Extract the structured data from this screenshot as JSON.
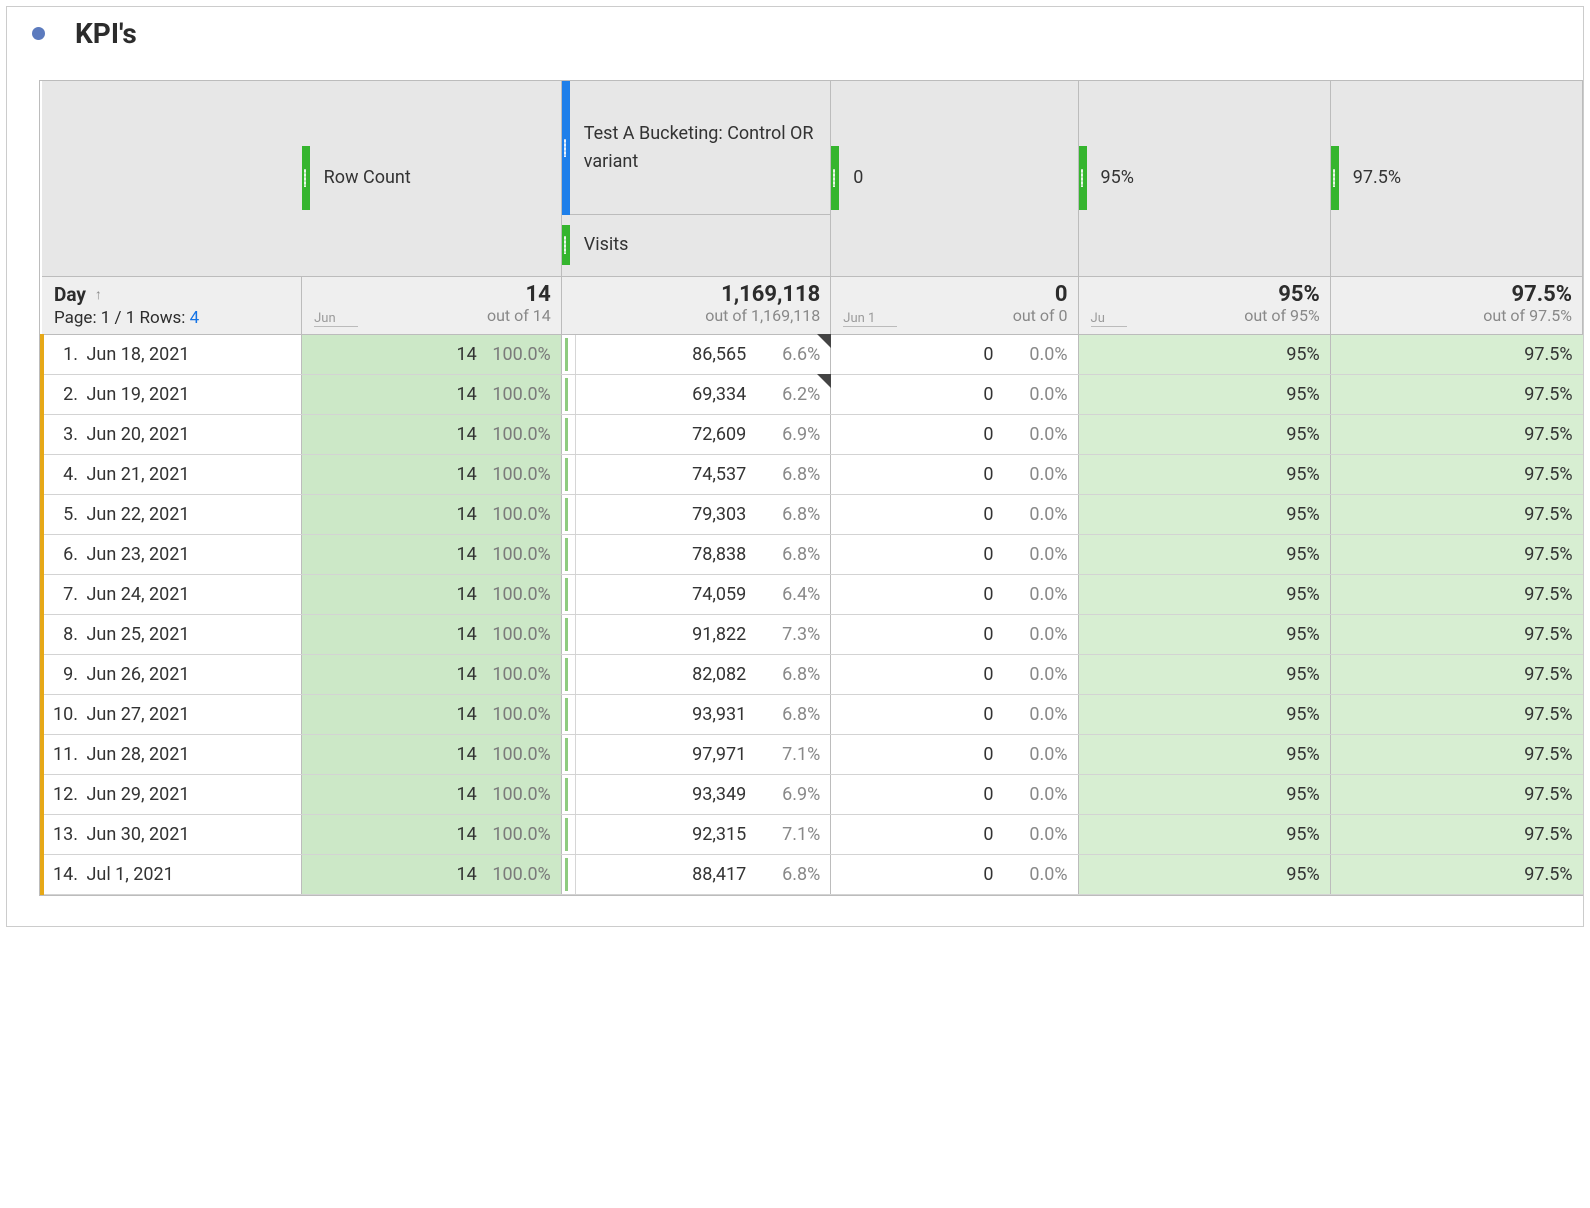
{
  "panel": {
    "title": "KPI's"
  },
  "headers": {
    "row_count": "Row Count",
    "bucketing": "Test A Bucketing: Control OR variant",
    "visits": "Visits",
    "zero": "0",
    "ninetyfive": "95%",
    "ninetysevenfive": "97.5%"
  },
  "summary": {
    "day_label": "Day",
    "page_prefix": "Page: ",
    "page": "1 / 1",
    "rows_prefix": " Rows: ",
    "rows": "4",
    "spark_rc": "Jun",
    "rc_big": "14",
    "rc_sub": "out of 14",
    "vis_big": "1,169,118",
    "vis_sub": "out of 1,169,118",
    "spark_vis": "Jun 1",
    "zero_big": "0",
    "zero_sub": "out of 0",
    "spark_zero": "Ju",
    "nf_big": "95%",
    "nf_sub": "out of 95%",
    "nsf_big": "97.5%",
    "nsf_sub": "out of 97.5%"
  },
  "rows": [
    {
      "idx": "1.",
      "date": "Jun 18, 2021",
      "rc": "14",
      "rc_pct": "100.0%",
      "vis": "86,565",
      "vis_pct": "6.6%",
      "anom": true,
      "z": "0",
      "zp": "0.0%",
      "nf": "95%",
      "nsf": "97.5%"
    },
    {
      "idx": "2.",
      "date": "Jun 19, 2021",
      "rc": "14",
      "rc_pct": "100.0%",
      "vis": "69,334",
      "vis_pct": "6.2%",
      "anom": true,
      "z": "0",
      "zp": "0.0%",
      "nf": "95%",
      "nsf": "97.5%"
    },
    {
      "idx": "3.",
      "date": "Jun 20, 2021",
      "rc": "14",
      "rc_pct": "100.0%",
      "vis": "72,609",
      "vis_pct": "6.9%",
      "anom": false,
      "z": "0",
      "zp": "0.0%",
      "nf": "95%",
      "nsf": "97.5%"
    },
    {
      "idx": "4.",
      "date": "Jun 21, 2021",
      "rc": "14",
      "rc_pct": "100.0%",
      "vis": "74,537",
      "vis_pct": "6.8%",
      "anom": false,
      "z": "0",
      "zp": "0.0%",
      "nf": "95%",
      "nsf": "97.5%"
    },
    {
      "idx": "5.",
      "date": "Jun 22, 2021",
      "rc": "14",
      "rc_pct": "100.0%",
      "vis": "79,303",
      "vis_pct": "6.8%",
      "anom": false,
      "z": "0",
      "zp": "0.0%",
      "nf": "95%",
      "nsf": "97.5%"
    },
    {
      "idx": "6.",
      "date": "Jun 23, 2021",
      "rc": "14",
      "rc_pct": "100.0%",
      "vis": "78,838",
      "vis_pct": "6.8%",
      "anom": false,
      "z": "0",
      "zp": "0.0%",
      "nf": "95%",
      "nsf": "97.5%"
    },
    {
      "idx": "7.",
      "date": "Jun 24, 2021",
      "rc": "14",
      "rc_pct": "100.0%",
      "vis": "74,059",
      "vis_pct": "6.4%",
      "anom": false,
      "z": "0",
      "zp": "0.0%",
      "nf": "95%",
      "nsf": "97.5%"
    },
    {
      "idx": "8.",
      "date": "Jun 25, 2021",
      "rc": "14",
      "rc_pct": "100.0%",
      "vis": "91,822",
      "vis_pct": "7.3%",
      "anom": false,
      "z": "0",
      "zp": "0.0%",
      "nf": "95%",
      "nsf": "97.5%"
    },
    {
      "idx": "9.",
      "date": "Jun 26, 2021",
      "rc": "14",
      "rc_pct": "100.0%",
      "vis": "82,082",
      "vis_pct": "6.8%",
      "anom": false,
      "z": "0",
      "zp": "0.0%",
      "nf": "95%",
      "nsf": "97.5%"
    },
    {
      "idx": "10.",
      "date": "Jun 27, 2021",
      "rc": "14",
      "rc_pct": "100.0%",
      "vis": "93,931",
      "vis_pct": "6.8%",
      "anom": false,
      "z": "0",
      "zp": "0.0%",
      "nf": "95%",
      "nsf": "97.5%"
    },
    {
      "idx": "11.",
      "date": "Jun 28, 2021",
      "rc": "14",
      "rc_pct": "100.0%",
      "vis": "97,971",
      "vis_pct": "7.1%",
      "anom": false,
      "z": "0",
      "zp": "0.0%",
      "nf": "95%",
      "nsf": "97.5%"
    },
    {
      "idx": "12.",
      "date": "Jun 29, 2021",
      "rc": "14",
      "rc_pct": "100.0%",
      "vis": "93,349",
      "vis_pct": "6.9%",
      "anom": false,
      "z": "0",
      "zp": "0.0%",
      "nf": "95%",
      "nsf": "97.5%"
    },
    {
      "idx": "13.",
      "date": "Jun 30, 2021",
      "rc": "14",
      "rc_pct": "100.0%",
      "vis": "92,315",
      "vis_pct": "7.1%",
      "anom": false,
      "z": "0",
      "zp": "0.0%",
      "nf": "95%",
      "nsf": "97.5%"
    },
    {
      "idx": "14.",
      "date": "Jul 1, 2021",
      "rc": "14",
      "rc_pct": "100.0%",
      "vis": "88,417",
      "vis_pct": "6.8%",
      "anom": false,
      "z": "0",
      "zp": "0.0%",
      "nf": "95%",
      "nsf": "97.5%"
    }
  ]
}
